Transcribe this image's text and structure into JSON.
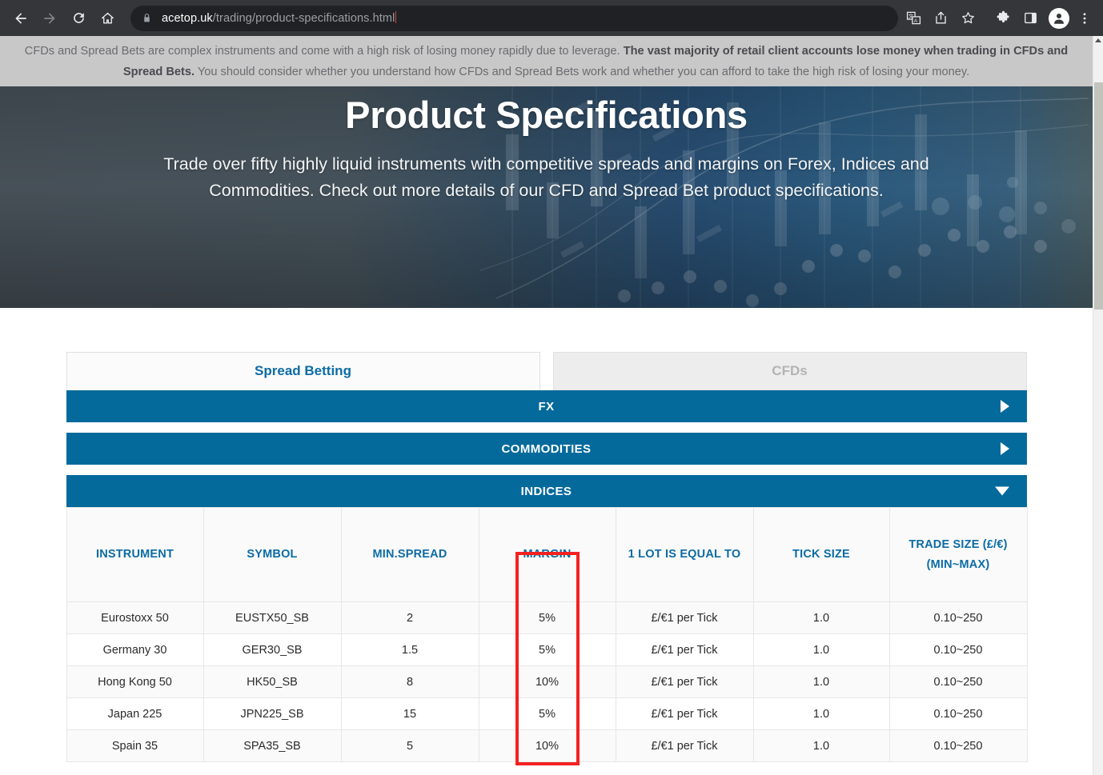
{
  "browser": {
    "nav": {
      "back_label": "Back",
      "forward_label": "Forward",
      "reload_label": "Reload",
      "home_label": "Home"
    },
    "omnibox": {
      "host": "acetop.uk",
      "path": "/trading/product-specifications.html",
      "security_icon": "lock-icon"
    },
    "actions": [
      {
        "name": "translate-icon",
        "label": "Translate"
      },
      {
        "name": "share-icon",
        "label": "Share"
      },
      {
        "name": "bookmark-star-icon",
        "label": "Bookmark"
      },
      {
        "name": "extensions-puzzle-icon",
        "label": "Extensions"
      },
      {
        "name": "side-panel-icon",
        "label": "Side panel"
      },
      {
        "name": "profile-avatar-icon",
        "label": "Profile"
      },
      {
        "name": "three-dot-menu-icon",
        "label": "Customize and control"
      }
    ]
  },
  "risk_warning": {
    "part1": "CFDs and Spread Bets are complex instruments and come with a high risk of losing money rapidly due to leverage. ",
    "bold": "The vast majority of retail client accounts lose money when trading in CFDs and Spread Bets.",
    "part2": " You should consider whether you understand how CFDs and Spread Bets work and whether you can afford to take the high risk of losing your money."
  },
  "hero": {
    "title": "Product Specifications",
    "subtitle": "Trade over fifty highly liquid instruments with competitive spreads and margins on Forex, Indices and Commodities. Check out more details of our CFD and Spread Bet product specifications."
  },
  "tabs": [
    {
      "label": "Spread Betting",
      "state": "active"
    },
    {
      "label": "CFDs",
      "state": "inactive"
    }
  ],
  "accordions": [
    {
      "label": "FX",
      "expanded": false,
      "arrow": "chevron-right-icon"
    },
    {
      "label": "COMMODITIES",
      "expanded": false,
      "arrow": "chevron-right-icon"
    },
    {
      "label": "INDICES",
      "expanded": true,
      "arrow": "chevron-down-icon"
    }
  ],
  "table": {
    "headers": [
      "INSTRUMENT",
      "SYMBOL",
      "MIN.SPREAD",
      "",
      "MARGIN",
      "1 LOT IS EQUAL TO",
      "TICK SIZE",
      "TRADE SIZE (£/€)"
    ],
    "header_trade_size_line1": "TRADE SIZE (£/€)",
    "header_trade_size_line2": "(MIN~MAX)",
    "rows": [
      {
        "instrument": "Eurostoxx 50",
        "symbol": "EUSTX50_SB",
        "min_spread": "2",
        "margin": "5%",
        "one_lot": "£/€1 per Tick",
        "tick_size": "1.0",
        "trade_size": "0.10~250"
      },
      {
        "instrument": "Germany 30",
        "symbol": "GER30_SB",
        "min_spread": "1.5",
        "margin": "5%",
        "one_lot": "£/€1 per Tick",
        "tick_size": "1.0",
        "trade_size": "0.10~250"
      },
      {
        "instrument": "Hong Kong 50",
        "symbol": "HK50_SB",
        "min_spread": "8",
        "margin": "10%",
        "one_lot": "£/€1 per Tick",
        "tick_size": "1.0",
        "trade_size": "0.10~250"
      },
      {
        "instrument": "Japan 225",
        "symbol": "JPN225_SB",
        "min_spread": "15",
        "margin": "5%",
        "one_lot": "£/€1 per Tick",
        "tick_size": "1.0",
        "trade_size": "0.10~250"
      },
      {
        "instrument": "Spain 35",
        "symbol": "SPA35_SB",
        "min_spread": "5",
        "margin": "10%",
        "one_lot": "£/€1 per Tick",
        "tick_size": "1.0",
        "trade_size": "0.10~250"
      }
    ]
  },
  "annotation": {
    "target_column": "MARGIN",
    "color": "#f42121"
  },
  "colors": {
    "brand_blue": "#046a9c",
    "link_blue": "#0b6ba5",
    "chrome_bg": "#35363a",
    "omnibox_bg": "#202124",
    "risk_bg": "#c8c8c8",
    "annotation_red": "#f42121"
  }
}
